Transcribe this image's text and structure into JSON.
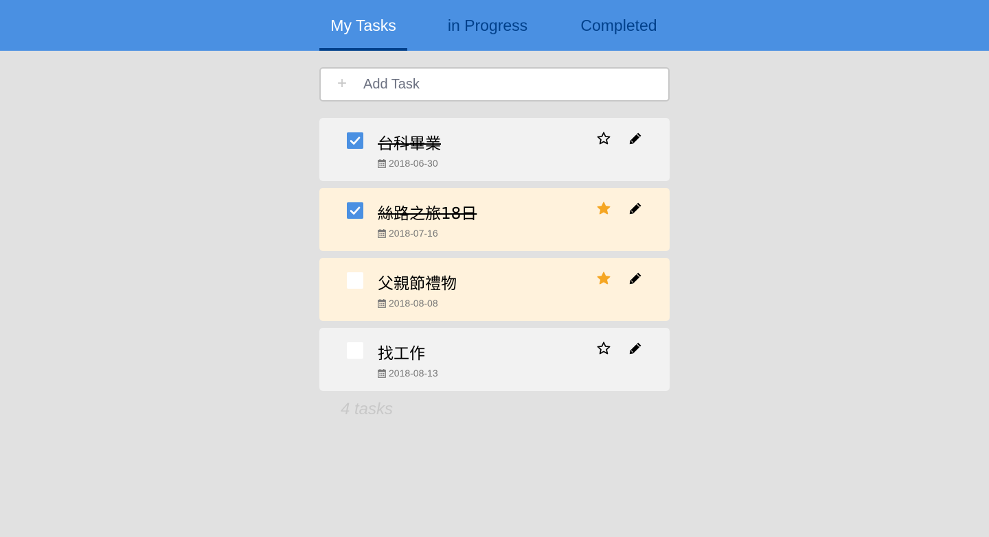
{
  "nav": {
    "tabs": [
      {
        "label": "My Tasks",
        "active": true
      },
      {
        "label": "in Progress",
        "active": false
      },
      {
        "label": "Completed",
        "active": false
      }
    ]
  },
  "add_task": {
    "placeholder": "Add Task",
    "icon": "plus-icon"
  },
  "tasks": [
    {
      "title": "台科畢業",
      "date": "2018-06-30",
      "done": true,
      "starred": false
    },
    {
      "title": "絲路之旅18日",
      "date": "2018-07-16",
      "done": true,
      "starred": true
    },
    {
      "title": "父親節禮物",
      "date": "2018-08-08",
      "done": false,
      "starred": true
    },
    {
      "title": "找工作",
      "date": "2018-08-13",
      "done": false,
      "starred": false
    }
  ],
  "footer": {
    "count_text": "4 tasks"
  },
  "colors": {
    "header": "#4a90e2",
    "tab_inactive": "#00408b",
    "tab_active": "#ffffff",
    "checkbox_checked": "#4a90e2",
    "star_filled": "#f5a623",
    "important_bg": "#fff2dc",
    "normal_bg": "#f2f2f2",
    "page_bg": "#e1e1e1"
  }
}
